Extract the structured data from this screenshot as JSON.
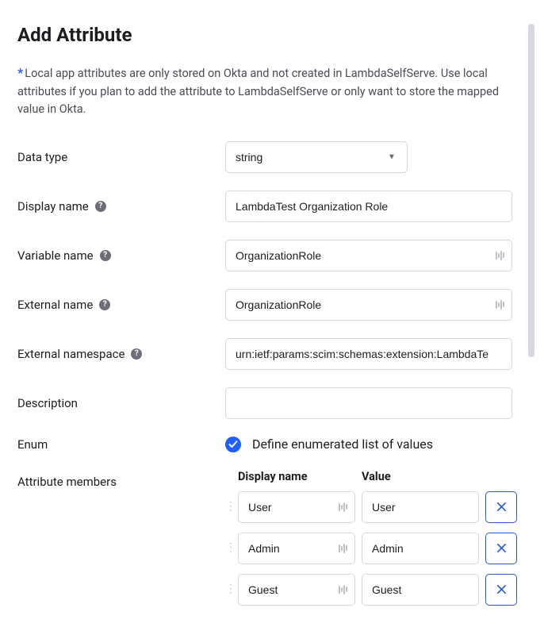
{
  "title": "Add Attribute",
  "info_text": "Local app attributes are only stored on Okta and not created in LambdaSelfServe. Use local attributes if you plan to add the attribute to LambdaSelfServe or only want to store the mapped value in Okta.",
  "labels": {
    "data_type": "Data type",
    "display_name": "Display name",
    "variable_name": "Variable name",
    "external_name": "External name",
    "external_namespace": "External namespace",
    "description": "Description",
    "enum": "Enum",
    "attribute_members": "Attribute members"
  },
  "values": {
    "data_type": "string",
    "display_name": "LambdaTest Organization Role",
    "variable_name": "OrganizationRole",
    "external_name": "OrganizationRole",
    "external_namespace": "urn:ietf:params:scim:schemas:extension:LambdaTe",
    "description": ""
  },
  "enum": {
    "checked": true,
    "label": "Define enumerated list of values"
  },
  "members": {
    "header_display": "Display name",
    "header_value": "Value",
    "rows": [
      {
        "display": "User",
        "value": "User"
      },
      {
        "display": "Admin",
        "value": "Admin"
      },
      {
        "display": "Guest",
        "value": "Guest"
      }
    ]
  }
}
